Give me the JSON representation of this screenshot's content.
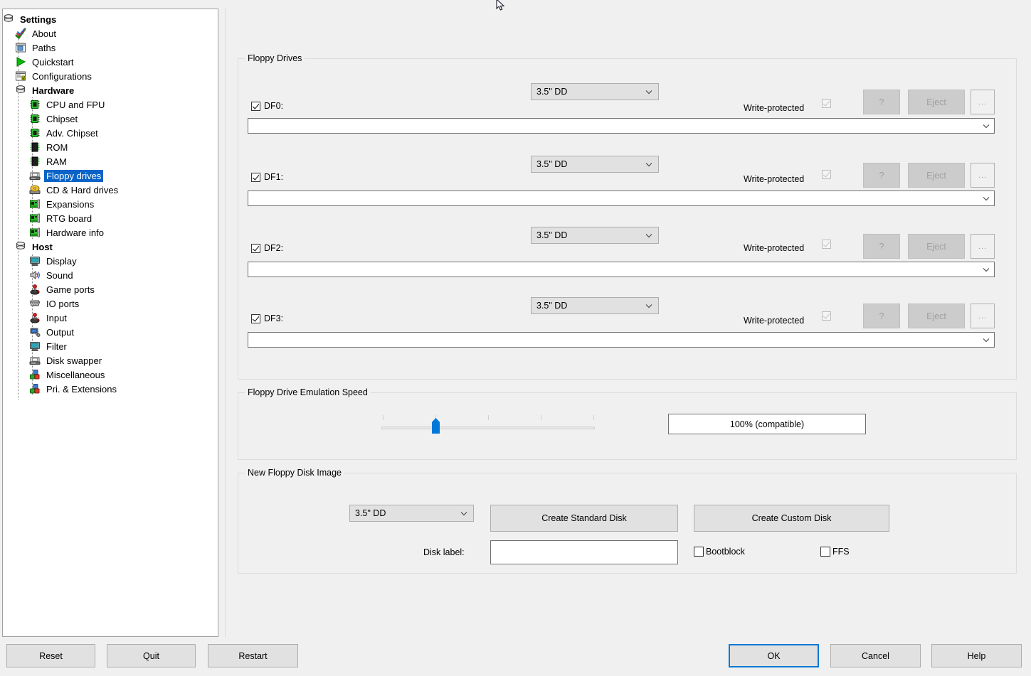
{
  "window": {
    "title": "Settings"
  },
  "sidebar": {
    "root": {
      "label": "Settings",
      "icon": "settings-stack-icon"
    },
    "items": [
      {
        "label": "About",
        "icon": "about-check-icon",
        "level": 1,
        "bold": false,
        "selected": false
      },
      {
        "label": "Paths",
        "icon": "paths-icon",
        "level": 1,
        "bold": false,
        "selected": false
      },
      {
        "label": "Quickstart",
        "icon": "play-green-icon",
        "level": 1,
        "bold": false,
        "selected": false
      },
      {
        "label": "Configurations",
        "icon": "configurations-icon",
        "level": 1,
        "bold": false,
        "selected": false
      },
      {
        "label": "Hardware",
        "icon": "hardware-stack-icon",
        "level": 1,
        "bold": true,
        "selected": false
      },
      {
        "label": "CPU and FPU",
        "icon": "chip-green-icon",
        "level": 2,
        "bold": false,
        "selected": false
      },
      {
        "label": "Chipset",
        "icon": "chip-green-icon",
        "level": 2,
        "bold": false,
        "selected": false
      },
      {
        "label": "Adv. Chipset",
        "icon": "chip-green-icon",
        "level": 2,
        "bold": false,
        "selected": false
      },
      {
        "label": "ROM",
        "icon": "chip-dark-icon",
        "level": 2,
        "bold": false,
        "selected": false
      },
      {
        "label": "RAM",
        "icon": "chip-dark-icon",
        "level": 2,
        "bold": false,
        "selected": false
      },
      {
        "label": "Floppy drives",
        "icon": "floppy-drive-icon",
        "level": 2,
        "bold": false,
        "selected": true
      },
      {
        "label": "CD & Hard drives",
        "icon": "cd-harddrive-icon",
        "level": 2,
        "bold": false,
        "selected": false
      },
      {
        "label": "Expansions",
        "icon": "board-card-icon",
        "level": 2,
        "bold": false,
        "selected": false
      },
      {
        "label": "RTG board",
        "icon": "board-card-icon",
        "level": 2,
        "bold": false,
        "selected": false
      },
      {
        "label": "Hardware info",
        "icon": "board-card-icon",
        "level": 2,
        "bold": false,
        "selected": false
      },
      {
        "label": "Host",
        "icon": "host-stack-icon",
        "level": 1,
        "bold": true,
        "selected": false
      },
      {
        "label": "Display",
        "icon": "monitor-icon",
        "level": 2,
        "bold": false,
        "selected": false
      },
      {
        "label": "Sound",
        "icon": "speaker-icon",
        "level": 2,
        "bold": false,
        "selected": false
      },
      {
        "label": "Game ports",
        "icon": "joystick-icon",
        "level": 2,
        "bold": false,
        "selected": false
      },
      {
        "label": "IO ports",
        "icon": "io-ports-icon",
        "level": 2,
        "bold": false,
        "selected": false
      },
      {
        "label": "Input",
        "icon": "joystick-icon",
        "level": 2,
        "bold": false,
        "selected": false
      },
      {
        "label": "Output",
        "icon": "output-icon",
        "level": 2,
        "bold": false,
        "selected": false
      },
      {
        "label": "Filter",
        "icon": "monitor-icon",
        "level": 2,
        "bold": false,
        "selected": false
      },
      {
        "label": "Disk swapper",
        "icon": "floppy-drive-icon",
        "level": 2,
        "bold": false,
        "selected": false
      },
      {
        "label": "Miscellaneous",
        "icon": "blocks-icon",
        "level": 2,
        "bold": false,
        "selected": false
      },
      {
        "label": "Pri. & Extensions",
        "icon": "blocks-icon",
        "level": 2,
        "bold": false,
        "selected": false
      }
    ]
  },
  "floppy_drives": {
    "group_title": "Floppy Drives",
    "drives": [
      {
        "label": "DF0:",
        "enabled": true,
        "type": "3.5\" DD",
        "write_protected_label": "Write-protected",
        "write_protected": true,
        "write_protected_disabled": true,
        "help_label": "?",
        "eject_label": "Eject",
        "browse_label": "...",
        "path": ""
      },
      {
        "label": "DF1:",
        "enabled": true,
        "type": "3.5\" DD",
        "write_protected_label": "Write-protected",
        "write_protected": true,
        "write_protected_disabled": true,
        "help_label": "?",
        "eject_label": "Eject",
        "browse_label": "...",
        "path": ""
      },
      {
        "label": "DF2:",
        "enabled": true,
        "type": "3.5\" DD",
        "write_protected_label": "Write-protected",
        "write_protected": true,
        "write_protected_disabled": true,
        "help_label": "?",
        "eject_label": "Eject",
        "browse_label": "...",
        "path": ""
      },
      {
        "label": "DF3:",
        "enabled": true,
        "type": "3.5\" DD",
        "write_protected_label": "Write-protected",
        "write_protected": true,
        "write_protected_disabled": true,
        "help_label": "?",
        "eject_label": "Eject",
        "browse_label": "...",
        "path": ""
      }
    ]
  },
  "emulation_speed": {
    "group_title": "Floppy Drive Emulation Speed",
    "value_label": "100% (compatible)",
    "tick_count": 5,
    "thumb_index": 1
  },
  "new_disk_image": {
    "group_title": "New Floppy Disk Image",
    "disk_type": "3.5\" DD",
    "create_standard_label": "Create Standard Disk",
    "create_custom_label": "Create Custom Disk",
    "disk_label_caption": "Disk label:",
    "disk_label_value": "",
    "bootblock_label": "Bootblock",
    "bootblock_checked": false,
    "ffs_label": "FFS",
    "ffs_checked": false
  },
  "bottom_bar": {
    "reset_label": "Reset",
    "quit_label": "Quit",
    "restart_label": "Restart",
    "ok_label": "OK",
    "cancel_label": "Cancel",
    "help_label": "Help"
  },
  "colors": {
    "accent": "#0078d7",
    "selection": "#0a64c8",
    "panel_bg": "#f0f0f0",
    "field_bg": "#ffffff"
  }
}
